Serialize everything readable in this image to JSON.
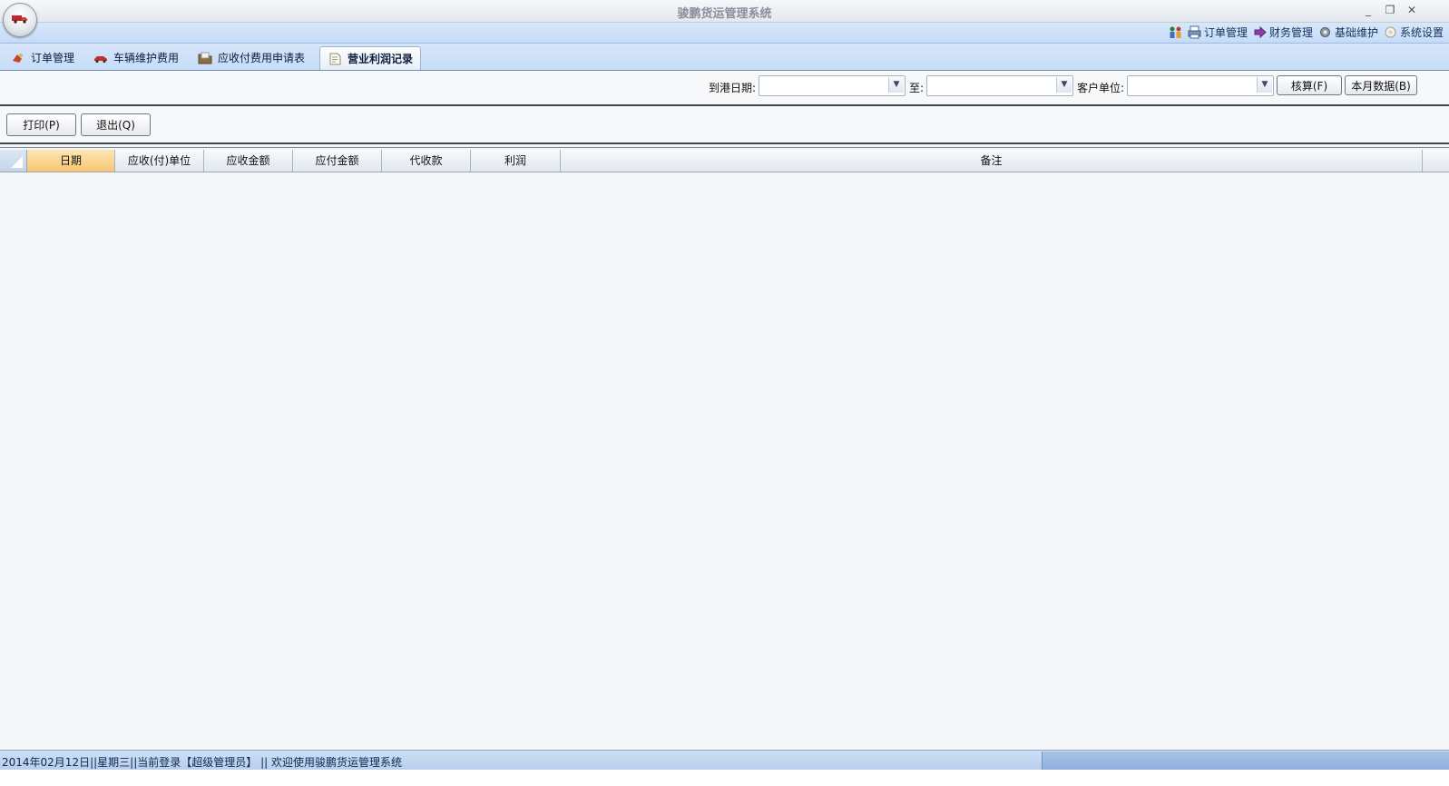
{
  "window": {
    "title": "骏鹏货运管理系统",
    "minimize": "_",
    "restore": "❐",
    "close": "✕"
  },
  "quick_access": {
    "items": [
      {
        "label": "订单管理",
        "icon": "printer-icon"
      },
      {
        "label": "财务管理",
        "icon": "arrow-icon"
      },
      {
        "label": "基础维护",
        "icon": "gear-icon"
      },
      {
        "label": "系统设置",
        "icon": "settings-icon"
      }
    ]
  },
  "tabs": [
    {
      "label": "订单管理",
      "icon": "order-icon"
    },
    {
      "label": "车辆维护费用",
      "icon": "car-icon"
    },
    {
      "label": "应收付费用申请表",
      "icon": "folder-icon"
    },
    {
      "label": "营业利润记录",
      "icon": "document-icon",
      "active": true
    }
  ],
  "filters": {
    "arrival_date_label": "到港日期:",
    "to_label": "至:",
    "customer_label": "客户单位:",
    "arrival_date_from": "",
    "arrival_date_to": "",
    "customer": "",
    "calculate_button": "核算(F)",
    "month_data_button": "本月数据(B)"
  },
  "actions": {
    "print_button": "打印(P)",
    "exit_button": "退出(Q)"
  },
  "grid": {
    "columns": [
      "日期",
      "应收(付)单位",
      "应收金额",
      "应付金额",
      "代收款",
      "利润",
      "备注"
    ],
    "rows": []
  },
  "status": {
    "text": "2014年02月12日||星期三||当前登录【超级管理员】 || 欢迎使用骏鹏货运管理系统"
  }
}
